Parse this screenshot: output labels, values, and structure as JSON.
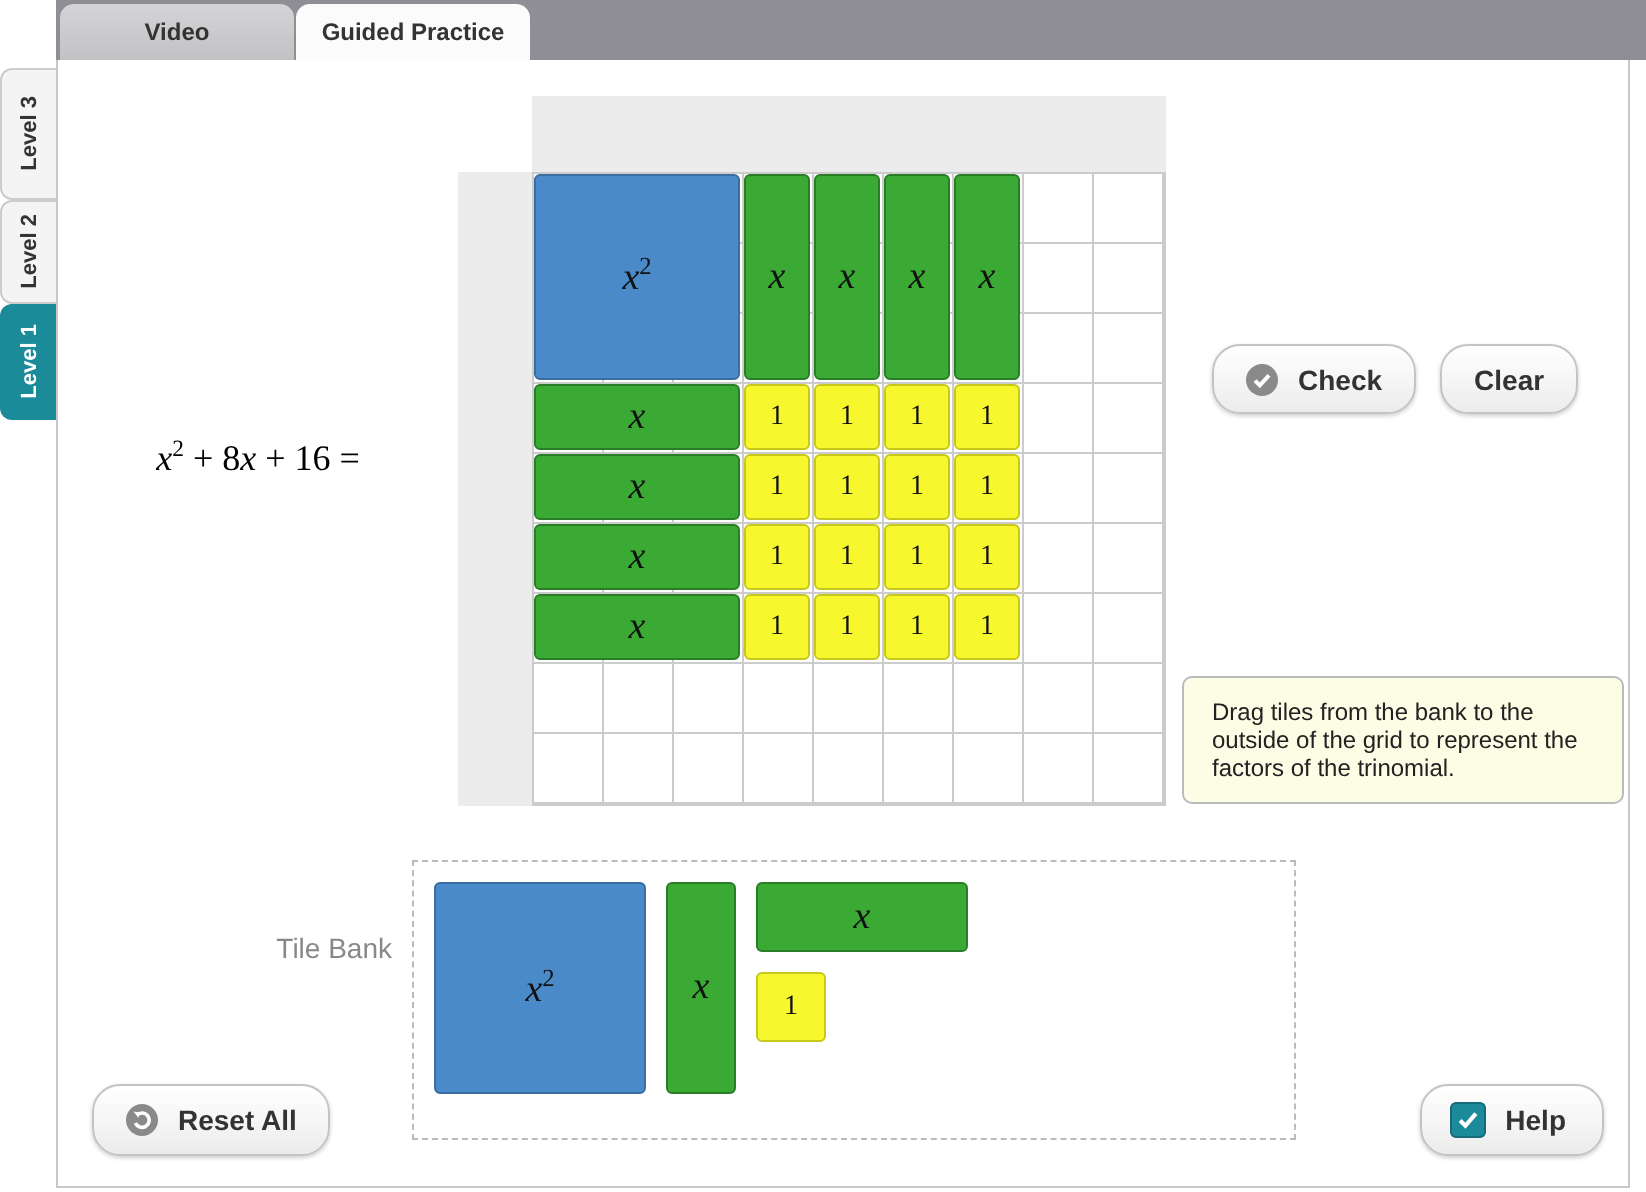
{
  "top_tabs": [
    {
      "label": "Video",
      "selected": false
    },
    {
      "label": "Guided Practice",
      "selected": true
    }
  ],
  "level_tabs": [
    {
      "label": "Level 3",
      "selected": false
    },
    {
      "label": "Level 2",
      "selected": false
    },
    {
      "label": "Level 1",
      "selected": true
    }
  ],
  "equation": [
    "*x*$^{2}$ + 8",
    "*x* + 16 ="
  ],
  "grid": {
    "rows": [
      {
        "tiles": [
          {
            "kind": "x_squared",
            "label": "x$^{2}$"
          },
          {
            "kind": "x_tall",
            "label": "x"
          },
          {
            "kind": "x_tall",
            "label": "x"
          },
          {
            "kind": "x_tall",
            "label": "x"
          },
          {
            "kind": "x_tall",
            "label": "x"
          }
        ]
      },
      {
        "tiles": [
          {
            "kind": "x_wide",
            "label": "x"
          },
          {
            "kind": "unit",
            "label": "1"
          },
          {
            "kind": "unit",
            "label": "1"
          },
          {
            "kind": "unit",
            "label": "1"
          },
          {
            "kind": "unit",
            "label": "1"
          }
        ]
      },
      {
        "tiles": [
          {
            "kind": "x_wide",
            "label": "x"
          },
          {
            "kind": "unit",
            "label": "1"
          },
          {
            "kind": "unit",
            "label": "1"
          },
          {
            "kind": "unit",
            "label": "1"
          },
          {
            "kind": "unit",
            "label": "1"
          }
        ]
      },
      {
        "tiles": [
          {
            "kind": "x_wide",
            "label": "x"
          },
          {
            "kind": "unit",
            "label": "1"
          },
          {
            "kind": "unit",
            "label": "1"
          },
          {
            "kind": "unit",
            "label": "1"
          },
          {
            "kind": "unit",
            "label": "1"
          }
        ]
      },
      {
        "tiles": [
          {
            "kind": "x_wide",
            "label": "x"
          },
          {
            "kind": "unit",
            "label": "1"
          },
          {
            "kind": "unit",
            "label": "1"
          },
          {
            "kind": "unit",
            "label": "1"
          },
          {
            "kind": "unit",
            "label": "1"
          }
        ]
      }
    ]
  },
  "check_button": {
    "label": "Check"
  },
  "clear_button": {
    "label": "Clear"
  },
  "hint": "Drag tiles from the bank to the outside of the grid to represent the factors of the trinomial.",
  "tile_bank": {
    "label": "Tile Bank",
    "tiles": [
      {
        "kind": "x_squared",
        "label": "x$^{2}$"
      },
      {
        "kind": "x_tall",
        "label": "x"
      },
      {
        "kind": "x_wide",
        "label": "x"
      },
      {
        "kind": "unit",
        "label": "1"
      }
    ]
  },
  "reset_button": {
    "label": "Reset All"
  },
  "help_button": {
    "label": "Help",
    "checked": true
  }
}
